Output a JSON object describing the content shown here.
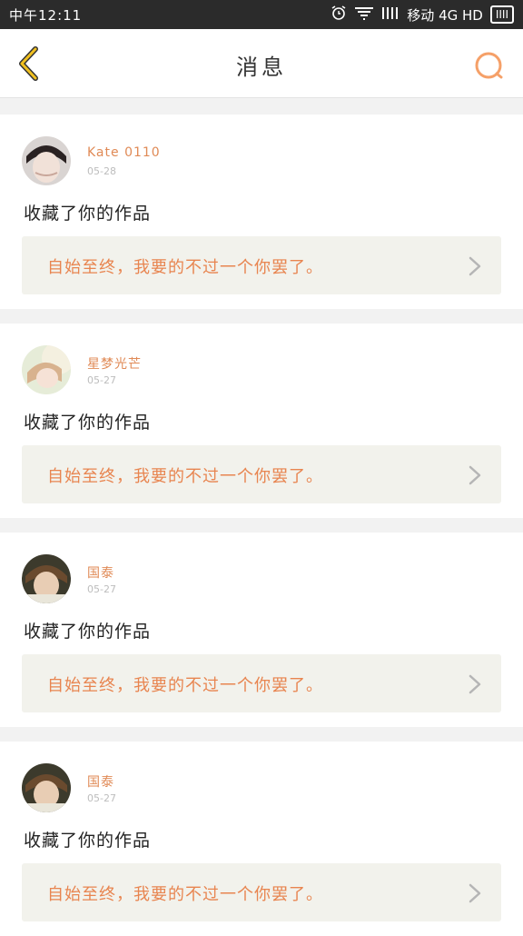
{
  "status_bar": {
    "time": "中午12:11",
    "carrier": "移动 4G HD",
    "battery": "IIII"
  },
  "header": {
    "title": "消息"
  },
  "colors": {
    "accent": "#e88550",
    "back_icon": "#f0c020",
    "search_icon": "#f5a068"
  },
  "messages": [
    {
      "name": "Kate 0110",
      "date": "05-28",
      "action": "收藏了你的作品",
      "quote": "自始至终，我要的不过一个你罢了。"
    },
    {
      "name": "星梦光芒",
      "date": "05-27",
      "action": "收藏了你的作品",
      "quote": "自始至终，我要的不过一个你罢了。"
    },
    {
      "name": "国泰",
      "date": "05-27",
      "action": "收藏了你的作品",
      "quote": "自始至终，我要的不过一个你罢了。"
    },
    {
      "name": "国泰",
      "date": "05-27",
      "action": "收藏了你的作品",
      "quote": "自始至终，我要的不过一个你罢了。"
    }
  ]
}
